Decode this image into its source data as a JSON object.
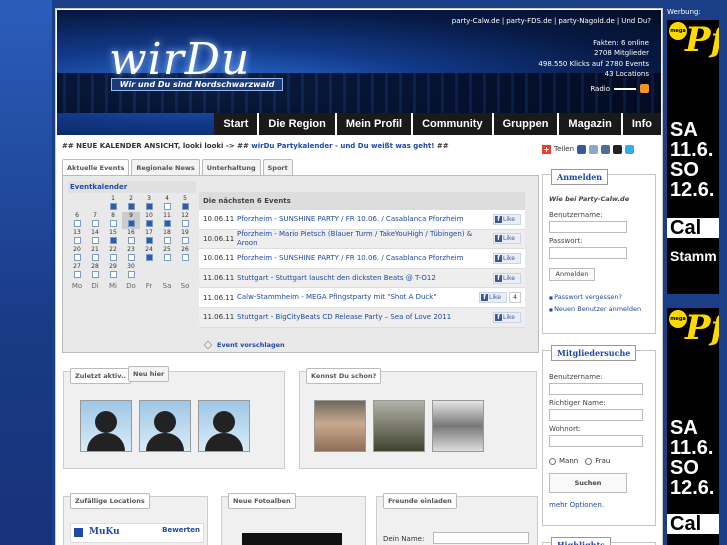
{
  "header": {
    "logo_text": "wirDu",
    "tagline": "Wir und Du sind Nordschwarzwald",
    "toplinks": [
      "party-Calw.de",
      "party-FDS.de",
      "party-Nagold.de",
      "Und Du?"
    ],
    "stats": [
      "Fakten: 6 online",
      "2708 Mitglieder",
      "498.550 Klicks auf 2780 Events",
      "43 Locations"
    ],
    "radio": "Radio"
  },
  "nav": [
    "Start",
    "Die Region",
    "Mein Profil",
    "Community",
    "Gruppen",
    "Magazin",
    "Info"
  ],
  "news": {
    "prefix": "## NEUE KALENDER ANSICHT, looki looki -> ## ",
    "highlight": "wirDu Partykalender - und Du weißt was geht!",
    "suffix": " ##"
  },
  "tabs": [
    "Aktuelle Events",
    "Regionale News",
    "Unterhaltung",
    "Sport"
  ],
  "calendar": {
    "title": "Eventkalender",
    "weeks": [
      [
        {
          "d": "",
          "m": ""
        },
        {
          "d": "",
          "m": ""
        },
        {
          "d": "1",
          "m": "f"
        },
        {
          "d": "2",
          "m": "f"
        },
        {
          "d": "3",
          "m": "f"
        },
        {
          "d": "4",
          "m": "e"
        },
        {
          "d": "5",
          "m": "f"
        }
      ],
      [
        {
          "d": "6",
          "m": "e"
        },
        {
          "d": "7",
          "m": "e"
        },
        {
          "d": "8",
          "m": "e"
        },
        {
          "d": "9",
          "m": "f",
          "today": true
        },
        {
          "d": "10",
          "m": "f"
        },
        {
          "d": "11",
          "m": "f"
        },
        {
          "d": "12",
          "m": "e"
        }
      ],
      [
        {
          "d": "13",
          "m": "e"
        },
        {
          "d": "14",
          "m": "e"
        },
        {
          "d": "15",
          "m": "f"
        },
        {
          "d": "16",
          "m": "e"
        },
        {
          "d": "17",
          "m": "f"
        },
        {
          "d": "18",
          "m": "e"
        },
        {
          "d": "19",
          "m": "e"
        }
      ],
      [
        {
          "d": "20",
          "m": "e"
        },
        {
          "d": "21",
          "m": "e"
        },
        {
          "d": "22",
          "m": "e"
        },
        {
          "d": "23",
          "m": "e"
        },
        {
          "d": "24",
          "m": "f"
        },
        {
          "d": "25",
          "m": "e"
        },
        {
          "d": "26",
          "m": "e"
        }
      ],
      [
        {
          "d": "27",
          "m": "e"
        },
        {
          "d": "28",
          "m": "e"
        },
        {
          "d": "29",
          "m": "e"
        },
        {
          "d": "30",
          "m": "e"
        },
        {
          "d": "",
          "m": ""
        },
        {
          "d": "",
          "m": ""
        },
        {
          "d": "",
          "m": ""
        }
      ]
    ],
    "days": [
      "Mo",
      "Di",
      "Mi",
      "Do",
      "Fr",
      "Sa",
      "So"
    ]
  },
  "events": {
    "heading": "Die nächsten 6 Events",
    "like_label": "Like",
    "rows": [
      {
        "date": "10.06.11",
        "text": "Pforzheim - SUNSHINE PARTY / FR 10.06. / Casablanca Pforzheim",
        "count": ""
      },
      {
        "date": "10.06.11",
        "text": "Pforzheim - Mario Pietsch (Blauer Turm / TakeYouHigh / Tübingen) & Aroon",
        "count": ""
      },
      {
        "date": "10.06.11",
        "text": "Pforzheim - SUNSHINE PARTY / FR 10.06. / Casablanca Pforzheim",
        "count": ""
      },
      {
        "date": "11.06.11",
        "text": "Stuttgart - Stuttgart lauscht den dicksten Beats @ T-O12",
        "count": ""
      },
      {
        "date": "11.06.11",
        "text": "Calw-Stammheim - MEGA Pfingstparty mit \"Shot A Duck\"",
        "count": "4"
      },
      {
        "date": "11.06.11",
        "text": "Stuttgart - BigCityBeats CD Release Party – Sea of Love 2011",
        "count": ""
      }
    ],
    "suggest": "Event vorschlagen"
  },
  "community": {
    "tab_recent": "Zuletzt aktiv..",
    "tab_new": "Neu hier",
    "tab_known": "Kennst Du schon?"
  },
  "bottom": {
    "locations_title": "Zufällige Locations",
    "location_name": "MuKu",
    "rate": "Bewerten",
    "albums_title": "Neue Fotoalben",
    "invite_title": "Freunde einladen",
    "your_name": "Dein Name:"
  },
  "sidebar": {
    "share": "Teilen",
    "login_title": "Anmelden",
    "login_sub": "Wie bei Party-Calw.de",
    "username": "Benutzername:",
    "password": "Passwort:",
    "login_btn": "Anmelden",
    "forgot": "Passwort vergessen?",
    "register": "Neuen Benutzer anmelden",
    "search_title": "Mitgliedersuche",
    "s_username": "Benutzername:",
    "realname": "Richtiger Name:",
    "city": "Wohnort:",
    "male": "Mann",
    "female": "Frau",
    "search_btn": "Suchen",
    "more": "mehr Optionen.",
    "highlights": "Highlights"
  },
  "ads": {
    "label": "Werbung:",
    "mega": "mega",
    "pf": "Pf",
    "date1": "SA 11.6.",
    "date2": "SO 12.6.",
    "cal": "Cal",
    "stamm": "Stamm"
  }
}
